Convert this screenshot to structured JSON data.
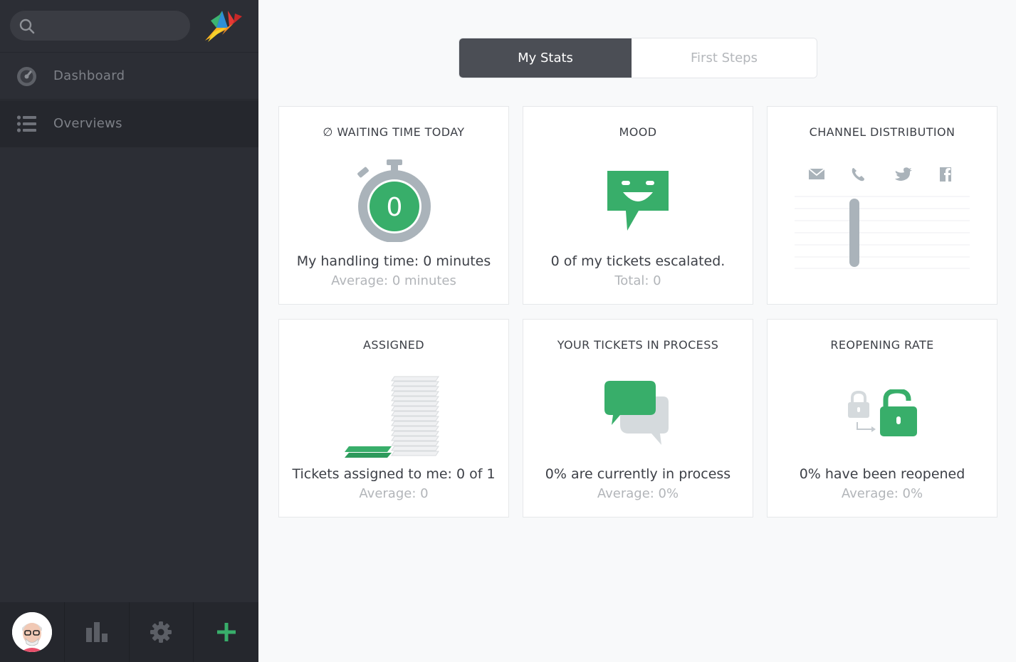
{
  "sidebar": {
    "search": {
      "placeholder": "",
      "value": ""
    },
    "nav": [
      {
        "label": "Dashboard",
        "icon": "dashboard-gauge-icon"
      },
      {
        "label": "Overviews",
        "icon": "list-icon"
      }
    ],
    "bottom": [
      {
        "icon": "user-avatar"
      },
      {
        "icon": "bar-chart-icon"
      },
      {
        "icon": "gear-icon"
      },
      {
        "icon": "plus-icon"
      }
    ]
  },
  "tabs": [
    {
      "label": "My Stats",
      "active": true
    },
    {
      "label": "First Steps",
      "active": false
    }
  ],
  "widgets": {
    "waiting_time": {
      "title": "∅ WAITING TIME TODAY",
      "value": "0",
      "main": "My handling time: 0 minutes",
      "sub": "Average: 0 minutes"
    },
    "mood": {
      "title": "MOOD",
      "main": "0 of my tickets escalated.",
      "sub": "Total: 0"
    },
    "channel_distribution": {
      "title": "CHANNEL DISTRIBUTION",
      "channels": [
        "email-icon",
        "phone-icon",
        "twitter-icon",
        "facebook-icon"
      ]
    },
    "assigned": {
      "title": "ASSIGNED",
      "main": "Tickets assigned to me: 0 of 1",
      "sub": "Average: 0"
    },
    "in_process": {
      "title": "YOUR TICKETS IN PROCESS",
      "main": "0% are currently in process",
      "sub": "Average: 0%"
    },
    "reopening": {
      "title": "REOPENING RATE",
      "main": "0% have been reopened",
      "sub": "Average: 0%"
    }
  },
  "colors": {
    "sidebar_bg": "#2c2e35",
    "accent_green": "#38ae6a",
    "gray_icon": "#aab3ba",
    "active_tab": "#4b4e55"
  }
}
